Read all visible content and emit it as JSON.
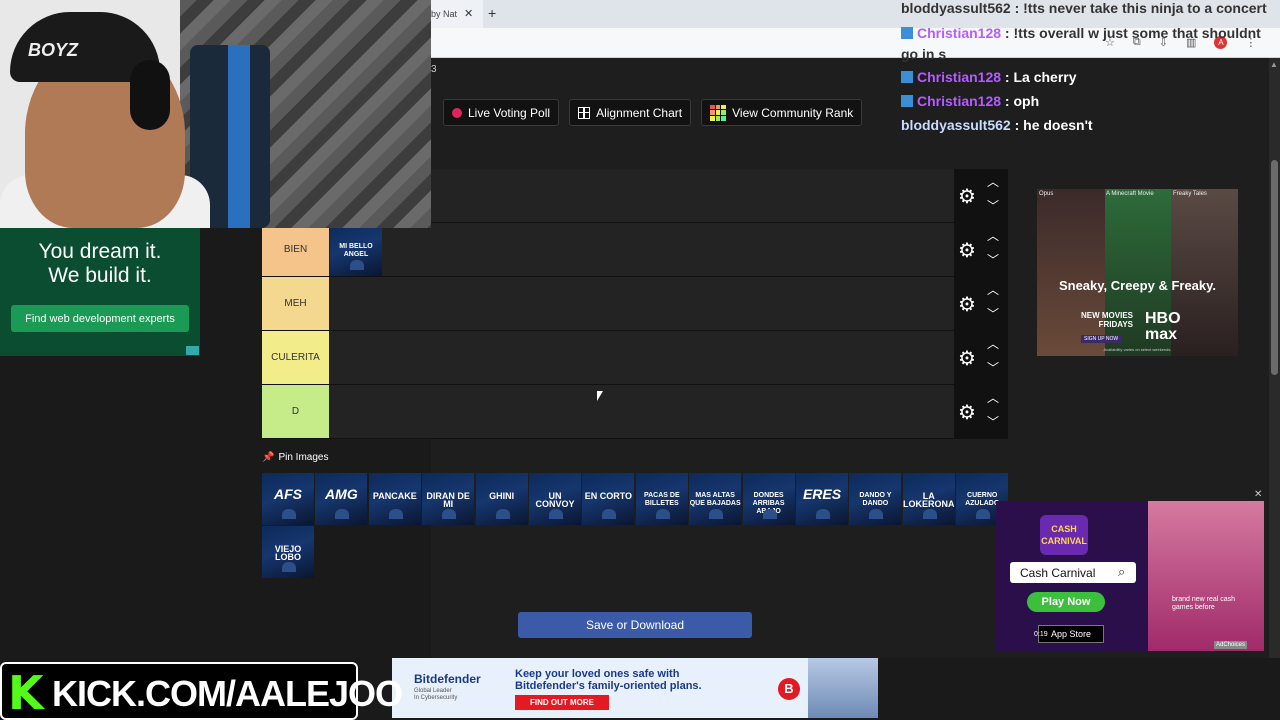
{
  "browser": {
    "tab_title": "by Nat",
    "tab_close": "✕",
    "new_tab": "+"
  },
  "page": {
    "counter": "3",
    "buttons": {
      "live_voting": "Live Voting Poll",
      "alignment": "Alignment Chart",
      "community_rank": "View Community Rank"
    },
    "tiers": [
      {
        "label": "",
        "color": "#1e1e1e"
      },
      {
        "label": "BIEN",
        "color": "#f4c48a"
      },
      {
        "label": "MEH",
        "color": "#f4d890"
      },
      {
        "label": "CULERITA",
        "color": "#f2ec8a"
      },
      {
        "label": "D",
        "color": "#c6ec8a"
      }
    ],
    "tier_item": "MI BELLO ANGEL",
    "pin_label": "Pin Images",
    "pool": [
      "AFS",
      "AMG",
      "PANCAKE",
      "DIRAN DE MI",
      "GHINI",
      "UN CONVOY",
      "EN CORTO",
      "PACAS DE BILLETES",
      "MAS ALTAS QUE BAJADAS",
      "DONDES ARRIBAS ABAJO",
      "ERES",
      "DANDO Y DANDO",
      "LA LOKERONA",
      "CUERNO AZULADO",
      "VIEJO LOBO"
    ],
    "save_label": "Save or Download"
  },
  "chat": [
    {
      "user": "bloddyassult562",
      "text": " : !tts never take this ninja to a concert",
      "user_color": "u-blue",
      "badge": false,
      "dark": true
    },
    {
      "user": "Christian128",
      "text": " : !tts overall w just some that shouldnt go in s",
      "user_color": "u-purple",
      "badge": true,
      "dark": true
    },
    {
      "user": "Christian128",
      "text": " : La cherry",
      "user_color": "u-purple",
      "badge": true,
      "dark": false
    },
    {
      "user": "Christian128",
      "text": " : oph",
      "user_color": "u-purple",
      "badge": true,
      "dark": false
    },
    {
      "user": "bloddyassult562",
      "text": " : he doesn't",
      "user_color": "u-blue",
      "badge": false,
      "dark": false
    }
  ],
  "webcam": {
    "cap_text": "BOYZ"
  },
  "green_ad": {
    "headline_1": "You dream it.",
    "headline_2": "We build it.",
    "cta": "Find web development experts"
  },
  "hbo_ad": {
    "top_1": "Opus",
    "top_2": "A Minecraft Movie",
    "top_3": "Freaky Tales",
    "tagline": "Sneaky, Creepy & Freaky.",
    "new_movies": "NEW MOVIES",
    "fridays": "FRIDAYS",
    "logo_1": "HBO",
    "logo_2": "max",
    "signup": "SIGN UP NOW",
    "avail": "Availability varies on select weekends."
  },
  "cash_ad": {
    "logo": "CASH CARNIVAL",
    "search": "Cash Carnival",
    "play": "Play Now",
    "store": "App Store",
    "time": "0:19",
    "brand_new": "brand new real cash games before",
    "adchoices": "AdChoices"
  },
  "bd_ad": {
    "brand": "Bitdefender",
    "sub_1": "Global Leader",
    "sub_2": "In Cybersecurity",
    "head_1": "Keep your loved ones safe with",
    "head_2": "Bitdefender's family-oriented plans.",
    "cta": "FIND OUT MORE",
    "logo": "B"
  },
  "kick": {
    "k": "K",
    "url": "KICK.COM/AALEJOO"
  }
}
